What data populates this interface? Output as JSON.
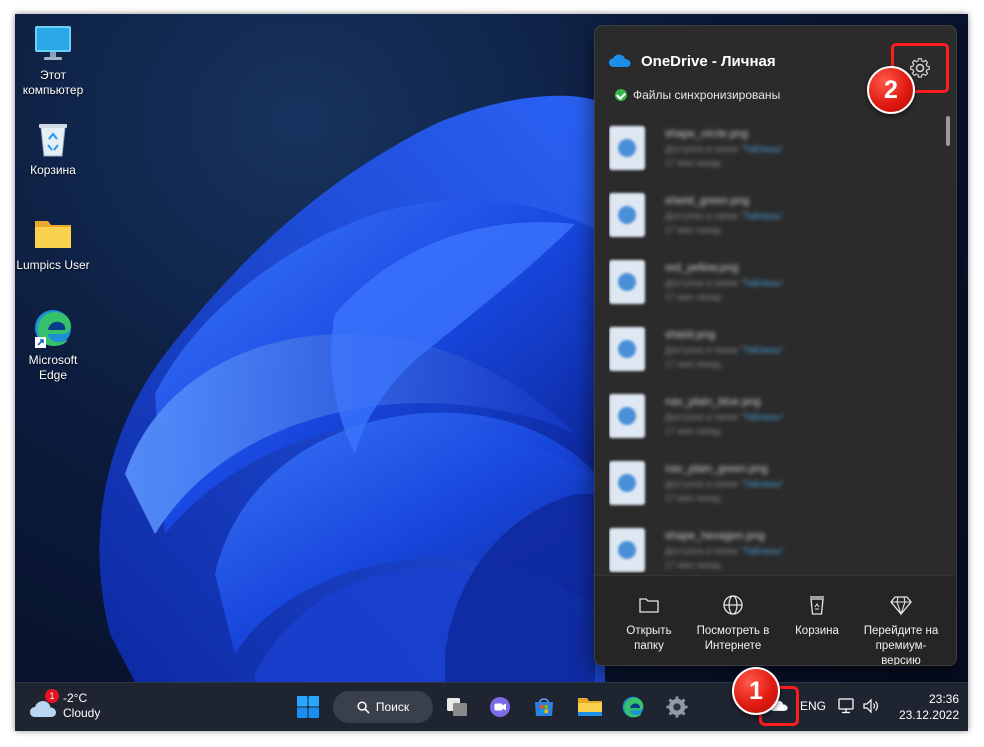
{
  "desktop": {
    "icons": [
      {
        "label": "Этот\nкомпьютер",
        "icon": "monitor-icon"
      },
      {
        "label": "Корзина",
        "icon": "recycle-bin-icon"
      },
      {
        "label": "Lumpics User",
        "icon": "folder-icon"
      },
      {
        "label": "Microsoft\nEdge",
        "icon": "edge-icon"
      }
    ]
  },
  "onedrive": {
    "title": "OneDrive - Личная",
    "status": "Файлы синхронизированы",
    "files": [
      {
        "name": "shape_circle.png",
        "location": "Доступно в папке \"",
        "folder": "Тайлины\"",
        "time": "17 мин назад"
      },
      {
        "name": "shield_green.png",
        "location": "Доступно в папке \"",
        "folder": "Тайлины\"",
        "time": "17 мин назад"
      },
      {
        "name": "red_yellow.png",
        "location": "Доступно в папке \"",
        "folder": "Тайлины\"",
        "time": "17 мин назад"
      },
      {
        "name": "shield.png",
        "location": "Доступно в папке \"",
        "folder": "Тайлины\"",
        "time": "17 мин назад"
      },
      {
        "name": "nav_plain_blue.png",
        "location": "Доступно в папке \"",
        "folder": "Тайлины\"",
        "time": "17 мин назад"
      },
      {
        "name": "nav_plain_green.png",
        "location": "Доступно в папке \"",
        "folder": "Тайлины\"",
        "time": "17 мин назад"
      },
      {
        "name": "shape_hexagon.png",
        "location": "Доступно в папке \"",
        "folder": "Тайлины\"",
        "time": "17 мин назад"
      }
    ],
    "actions": [
      {
        "label": "Открыть\nпапку",
        "icon": "folder-outline-icon"
      },
      {
        "label": "Посмотреть в\nИнтернете",
        "icon": "globe-icon"
      },
      {
        "label": "Корзина",
        "icon": "trash-icon"
      },
      {
        "label": "Перейдите на\nпремиум-\nверсию",
        "icon": "diamond-icon"
      }
    ]
  },
  "taskbar": {
    "weather_badge": "1",
    "weather_temp": "-2°C",
    "weather_desc": "Cloudy",
    "search_label": "Поиск",
    "language": "ENG",
    "time": "23:36",
    "date": "23.12.2022"
  },
  "callouts": {
    "one": "1",
    "two": "2"
  },
  "colors": {
    "highlight": "#ff1c1c",
    "accent": "#0078d4",
    "taskbar": "#1f2431",
    "flyout": "#2b2b2b"
  }
}
